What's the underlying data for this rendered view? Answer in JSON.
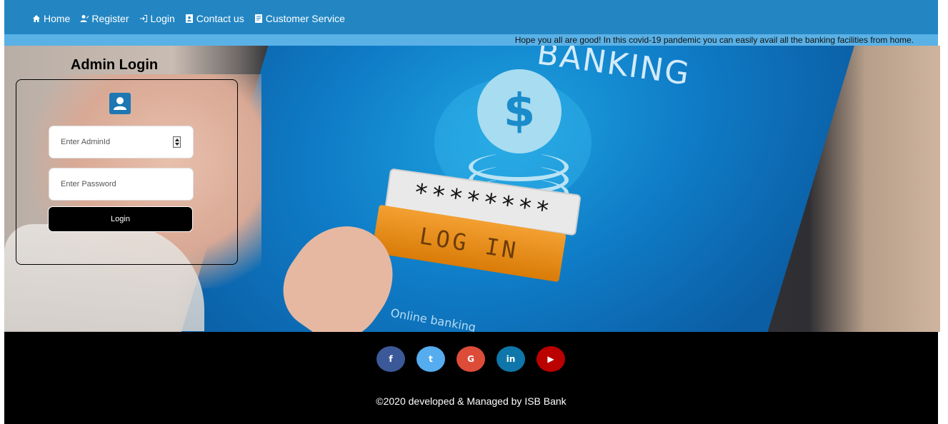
{
  "nav": {
    "items": [
      {
        "label": "Home",
        "icon": "home-icon"
      },
      {
        "label": "Register",
        "icon": "register-icon"
      },
      {
        "label": "Login",
        "icon": "login-icon"
      },
      {
        "label": "Contact us",
        "icon": "contact-icon"
      },
      {
        "label": "Customer Service",
        "icon": "service-icon"
      }
    ]
  },
  "marquee": {
    "text": "Hope you all are good! In this covid-19 pandemic you can easily avail all the banking facilities from home."
  },
  "hero": {
    "banking_text": "BANKING",
    "password_mask": "********",
    "login_graphic": "LOG IN",
    "online_text": "Online banking"
  },
  "admin_login": {
    "title": "Admin Login",
    "admin_id_placeholder": "Enter AdminId",
    "password_placeholder": "Enter Password",
    "login_button": "Login"
  },
  "footer": {
    "social": [
      {
        "name": "facebook",
        "glyph": "f",
        "color": "#3b5998"
      },
      {
        "name": "twitter",
        "glyph": "t",
        "color": "#55acee"
      },
      {
        "name": "google",
        "glyph": "G",
        "color": "#dd4b39"
      },
      {
        "name": "linkedin",
        "glyph": "in",
        "color": "#0e76a8"
      },
      {
        "name": "youtube",
        "glyph": "▶",
        "color": "#bb0000"
      }
    ],
    "copyright": "©2020 developed & Managed by ISB Bank"
  },
  "colors": {
    "navbar": "#2386c3",
    "marquee": "#5ab1e6",
    "footer": "#000000",
    "user_icon": "#1d77b3"
  }
}
